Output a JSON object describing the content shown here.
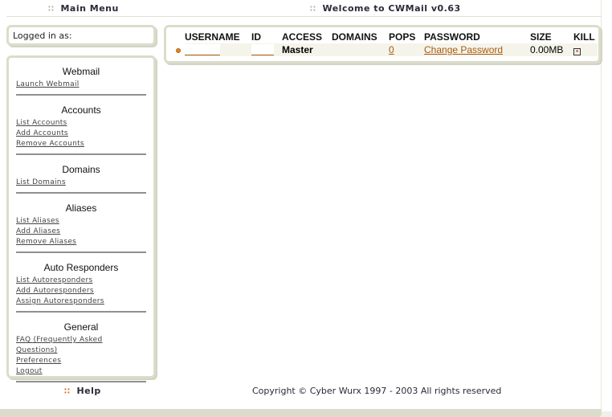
{
  "header": {
    "menu_title": "Main Menu",
    "welcome_title": "Welcome to CWMail v0.63"
  },
  "login": {
    "label": "Logged in as:"
  },
  "sidebar": {
    "sections": [
      {
        "title": "Webmail",
        "links": [
          "Launch Webmail"
        ]
      },
      {
        "title": "Accounts",
        "links": [
          "List Accounts",
          "Add Accounts",
          "Remove Accounts"
        ]
      },
      {
        "title": "Domains",
        "links": [
          "List Domains"
        ]
      },
      {
        "title": "Aliases",
        "links": [
          "List Aliases",
          "Add Aliases",
          "Remove Aliases"
        ]
      },
      {
        "title": "Auto Responders",
        "links": [
          "List Autoresponders",
          "Add Autoresponders",
          "Assign Autoresponders"
        ]
      },
      {
        "title": "General",
        "links": [
          "FAQ (Frequently Asked Questions)",
          "Preferences",
          "Logout"
        ]
      }
    ]
  },
  "table": {
    "columns": [
      "USERNAME",
      "ID",
      "ACCESS",
      "DOMAINS",
      "POPS",
      "PASSWORD",
      "SIZE",
      "KILL"
    ],
    "rows": [
      {
        "username": "",
        "id": "",
        "access": "Master",
        "domains": "",
        "pops": "0",
        "password": "Change Password",
        "size": "0.00MB",
        "kill": "☒"
      }
    ]
  },
  "footer": {
    "help_label": "Help",
    "copyright": "Copyright © Cyber Wurx 1997 - 2003 All rights reserved"
  },
  "colors": {
    "link_accent": "#a85a10",
    "frame": "#dcdccc",
    "bullet": "#e08a20"
  }
}
